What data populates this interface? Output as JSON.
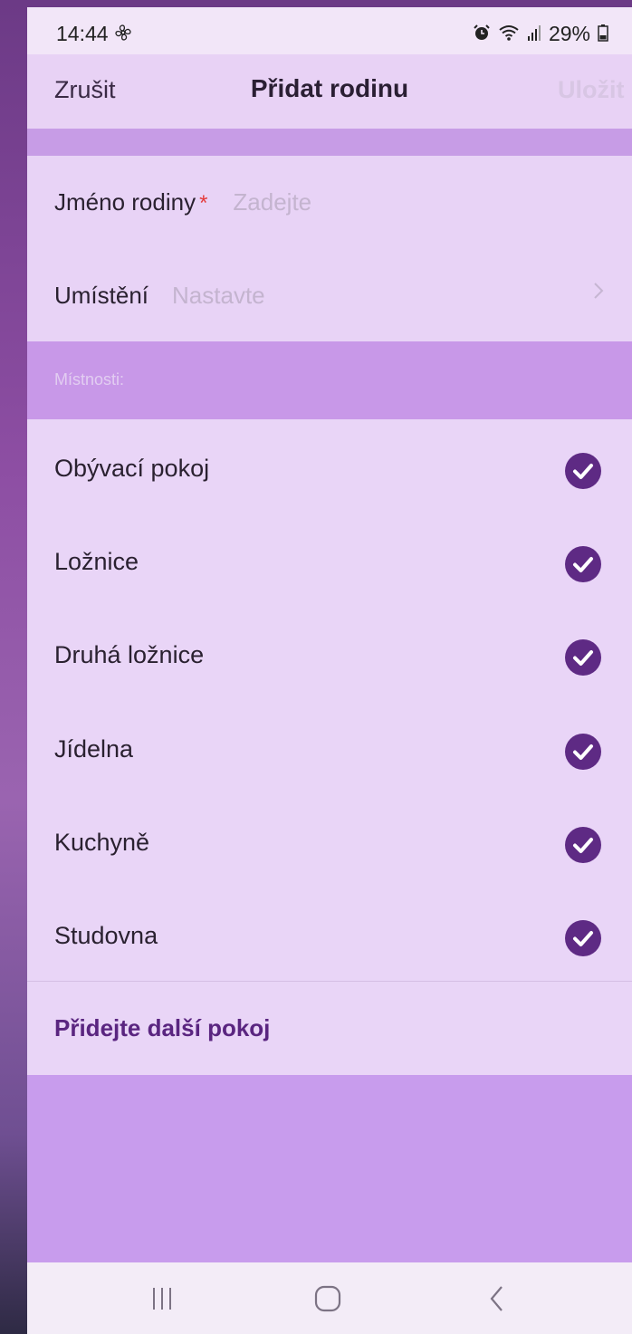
{
  "status_bar": {
    "time": "14:44",
    "battery": "29%"
  },
  "header": {
    "cancel_label": "Zrušit",
    "title": "Přidat rodinu",
    "save_label": "Uložit"
  },
  "form": {
    "family_name_label": "Jméno rodiny",
    "required_marker": "*",
    "family_name_placeholder": "Zadejte",
    "location_label": "Umístění",
    "location_placeholder": "Nastavte"
  },
  "rooms": {
    "section_label": "Místnosti:",
    "items": [
      {
        "label": "Obývací pokoj",
        "checked": true
      },
      {
        "label": "Ložnice",
        "checked": true
      },
      {
        "label": "Druhá ložnice",
        "checked": true
      },
      {
        "label": "Jídelna",
        "checked": true
      },
      {
        "label": "Kuchyně",
        "checked": true
      },
      {
        "label": "Studovna",
        "checked": true
      }
    ],
    "add_room_label": "Přidejte další pokoj"
  },
  "colors": {
    "accent": "#5a2580",
    "check_fill": "#5e2a84",
    "required": "#e43b3b"
  }
}
